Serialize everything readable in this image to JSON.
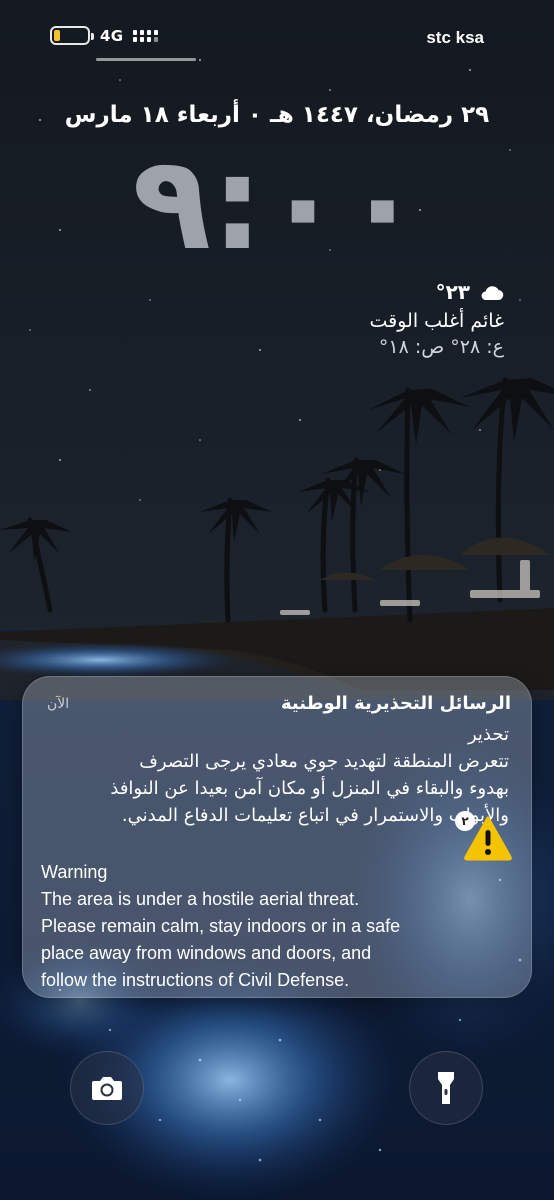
{
  "status_bar": {
    "network": "4G",
    "carrier": "stc ksa"
  },
  "lock_screen": {
    "date": "٢٩ رمضان، ١٤٤٧ هـ ٠ أربعاء ١٨ مارس",
    "time": "٩:٠٠"
  },
  "weather": {
    "temperature": "٢٣°",
    "condition": "غائم أغلب الوقت",
    "range": "ع: ٢٨° ص: ١٨°",
    "icon": "cloud-icon"
  },
  "notification": {
    "app": "الرسائل التحذيرية الوطنية",
    "time": "الآن",
    "heading_ar": "تحذير",
    "lines_ar": [
      "تتعرض المنطقة لتهديد جوي معادي يرجى التصرف",
      "بهدوء والبقاء في المنزل أو مكان آمن بعيدا عن النوافذ",
      "والأبواب والاستمرار في اتباع تعليمات الدفاع المدني."
    ],
    "badge_count": "٢",
    "heading_en": "Warning",
    "lines_en": [
      "The area is under a hostile aerial threat.",
      "Please remain calm, stay indoors or in a safe",
      "place away from windows and doors, and",
      "follow the instructions of Civil Defense."
    ],
    "icon": "warning-icon",
    "warning_color": "#f5c400"
  },
  "controls": {
    "camera_icon": "camera-icon",
    "flashlight_icon": "flashlight-icon"
  }
}
